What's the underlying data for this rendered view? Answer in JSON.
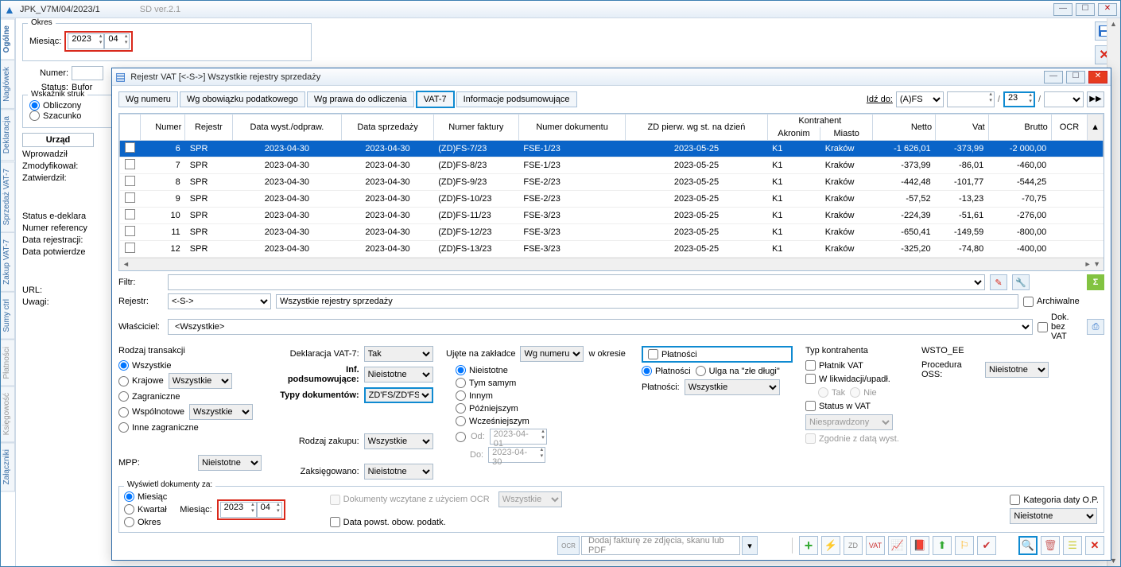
{
  "mainWindow": {
    "title": "JPK_V7M/04/2023/1",
    "version": "SD ver.2.1",
    "sideTabs": [
      "Ogólne",
      "Nagłówek",
      "Deklaracja",
      "Sprzedaż VAT-7",
      "Zakup VAT-7",
      "Sumy ctrl",
      "Płatności",
      "Księgowość",
      "Załączniki"
    ],
    "okres": {
      "label": "Okres",
      "miesiacLabel": "Miesiąc:",
      "year": "2023",
      "month": "04"
    },
    "numerLabel": "Numer:",
    "statusLabel": "Status:",
    "statusValue": "Bufor",
    "wskLabel": "Wskaźnik struk",
    "obliczony": "Obliczony",
    "szacunk": "Szacunko",
    "urzad": "Urząd",
    "wprowadzil": "Wprowadził",
    "zmodyfikowal": "Zmodyfikował:",
    "zatwierdzil": "Zatwierdził:",
    "statusE": "Status e-deklara",
    "numerRef": "Numer referency",
    "dataRej": "Data rejestracji:",
    "dataPot": "Data potwierdze",
    "url": "URL:",
    "uwagi": "Uwagi:"
  },
  "modal": {
    "title": "Rejestr VAT   [<-S->]   Wszystkie rejestry sprzedaży",
    "tabs": [
      "Wg numeru",
      "Wg obowiązku podatkowego",
      "Wg prawa do odliczenia",
      "VAT-7",
      "Informacje podsumowujące"
    ],
    "goto": {
      "label": "Idź do:",
      "sel1": "(A)FS",
      "num": "23"
    },
    "grid": {
      "headers": {
        "numer": "Numer",
        "rejestr": "Rejestr",
        "dataWyst": "Data wyst./odpraw.",
        "dataSprz": "Data sprzedaży",
        "nrFakt": "Numer faktury",
        "nrDok": "Numer dokumentu",
        "zd": "ZD pierw. wg st. na dzień",
        "kontrahent": "Kontrahent",
        "akronim": "Akronim",
        "miasto": "Miasto",
        "netto": "Netto",
        "vat": "Vat",
        "brutto": "Brutto",
        "ocr": "OCR"
      },
      "rows": [
        {
          "n": "6",
          "rej": "SPR",
          "dw": "2023-04-30",
          "ds": "2023-04-30",
          "nf": "(ZD)FS-7/23",
          "nd": "FSE-1/23",
          "zd": "2023-05-25",
          "ak": "K1",
          "mi": "Kraków",
          "net": "-1 626,01",
          "vat": "-373,99",
          "br": "-2 000,00",
          "sel": true
        },
        {
          "n": "7",
          "rej": "SPR",
          "dw": "2023-04-30",
          "ds": "2023-04-30",
          "nf": "(ZD)FS-8/23",
          "nd": "FSE-1/23",
          "zd": "2023-05-25",
          "ak": "K1",
          "mi": "Kraków",
          "net": "-373,99",
          "vat": "-86,01",
          "br": "-460,00"
        },
        {
          "n": "8",
          "rej": "SPR",
          "dw": "2023-04-30",
          "ds": "2023-04-30",
          "nf": "(ZD)FS-9/23",
          "nd": "FSE-2/23",
          "zd": "2023-05-25",
          "ak": "K1",
          "mi": "Kraków",
          "net": "-442,48",
          "vat": "-101,77",
          "br": "-544,25"
        },
        {
          "n": "9",
          "rej": "SPR",
          "dw": "2023-04-30",
          "ds": "2023-04-30",
          "nf": "(ZD)FS-10/23",
          "nd": "FSE-2/23",
          "zd": "2023-05-25",
          "ak": "K1",
          "mi": "Kraków",
          "net": "-57,52",
          "vat": "-13,23",
          "br": "-70,75"
        },
        {
          "n": "10",
          "rej": "SPR",
          "dw": "2023-04-30",
          "ds": "2023-04-30",
          "nf": "(ZD)FS-11/23",
          "nd": "FSE-3/23",
          "zd": "2023-05-25",
          "ak": "K1",
          "mi": "Kraków",
          "net": "-224,39",
          "vat": "-51,61",
          "br": "-276,00"
        },
        {
          "n": "11",
          "rej": "SPR",
          "dw": "2023-04-30",
          "ds": "2023-04-30",
          "nf": "(ZD)FS-12/23",
          "nd": "FSE-3/23",
          "zd": "2023-05-25",
          "ak": "K1",
          "mi": "Kraków",
          "net": "-650,41",
          "vat": "-149,59",
          "br": "-800,00"
        },
        {
          "n": "12",
          "rej": "SPR",
          "dw": "2023-04-30",
          "ds": "2023-04-30",
          "nf": "(ZD)FS-13/23",
          "nd": "FSE-3/23",
          "zd": "2023-05-25",
          "ak": "K1",
          "mi": "Kraków",
          "net": "-325,20",
          "vat": "-74,80",
          "br": "-400,00"
        }
      ]
    },
    "filtr": {
      "label": "Filtr:",
      "rejestrLabel": "Rejestr:",
      "rejestrVal": "<-S->",
      "rejestrDesc": "Wszystkie rejestry sprzedaży",
      "wlascicielLabel": "Właściciel:",
      "wlascicielVal": "<Wszystkie>",
      "archiwalne": "Archiwalne",
      "dokBezVat": "Dok. bez VAT"
    },
    "rodzajTrans": {
      "title": "Rodzaj transakcji",
      "opts": [
        "Wszystkie",
        "Krajowe",
        "Zagraniczne",
        "Wspólnotowe",
        "Inne zagraniczne"
      ],
      "wszystkie": "Wszystkie",
      "mppLabel": "MPP:",
      "mppVal": "Nieistotne"
    },
    "dekl": {
      "deklLabel": "Deklaracja VAT-7:",
      "deklVal": "Tak",
      "infLabel": "Inf. podsumowujące:",
      "infVal": "Nieistotne",
      "typyLabel": "Typy dokumentów:",
      "typyVal": "ZD'FS/ZD'FSK",
      "rodzajZakLabel": "Rodzaj zakupu:",
      "rodzajZakVal": "Wszystkie",
      "zaksLabel": "Zaksięgowano:",
      "zaksVal": "Nieistotne"
    },
    "ujete": {
      "title": "Ujęte na zakładce",
      "sel": "Wg numeru",
      "wokresie": "w okresie",
      "opts": [
        "Nieistotne",
        "Tym samym",
        "Innym",
        "Późniejszym",
        "Wcześniejszym"
      ],
      "odLabel": "Od:",
      "odVal": "2023-04-01",
      "doLabel": "Do:",
      "doVal": "2023-04-30"
    },
    "plat": {
      "title": "Płatności",
      "opts": [
        "Płatności",
        "Ulga na \"złe długi\""
      ],
      "platLabel": "Płatności:",
      "platVal": "Wszystkie"
    },
    "typKontr": {
      "title": "Typ kontrahenta",
      "platnik": "Płatnik VAT",
      "likw": "W likwidacji/upadł.",
      "tak": "Tak",
      "nie": "Nie",
      "statusVat": "Status w VAT",
      "statusVal": "Niesprawdzony",
      "zgodnie": "Zgodnie z datą wyst."
    },
    "wsto": {
      "title": "WSTO_EE",
      "procLabel": "Procedura OSS:",
      "procVal": "Nieistotne"
    },
    "wyswietl": {
      "title": "Wyświetl dokumenty za:",
      "opts": [
        "Miesiąc",
        "Kwartał",
        "Okres"
      ],
      "miesiacLabel": "Miesiąc:",
      "year": "2023",
      "month": "04",
      "ocrLabel": "Dokumenty wczytane z użyciem OCR",
      "ocrSel": "Wszystkie",
      "dataPow": "Data powst. obow. podatk.",
      "katLabel": "Kategoria daty O.P.",
      "katVal": "Nieistotne"
    },
    "ocrBar": "Dodaj fakturę ze zdjęcia, skanu lub PDF"
  }
}
